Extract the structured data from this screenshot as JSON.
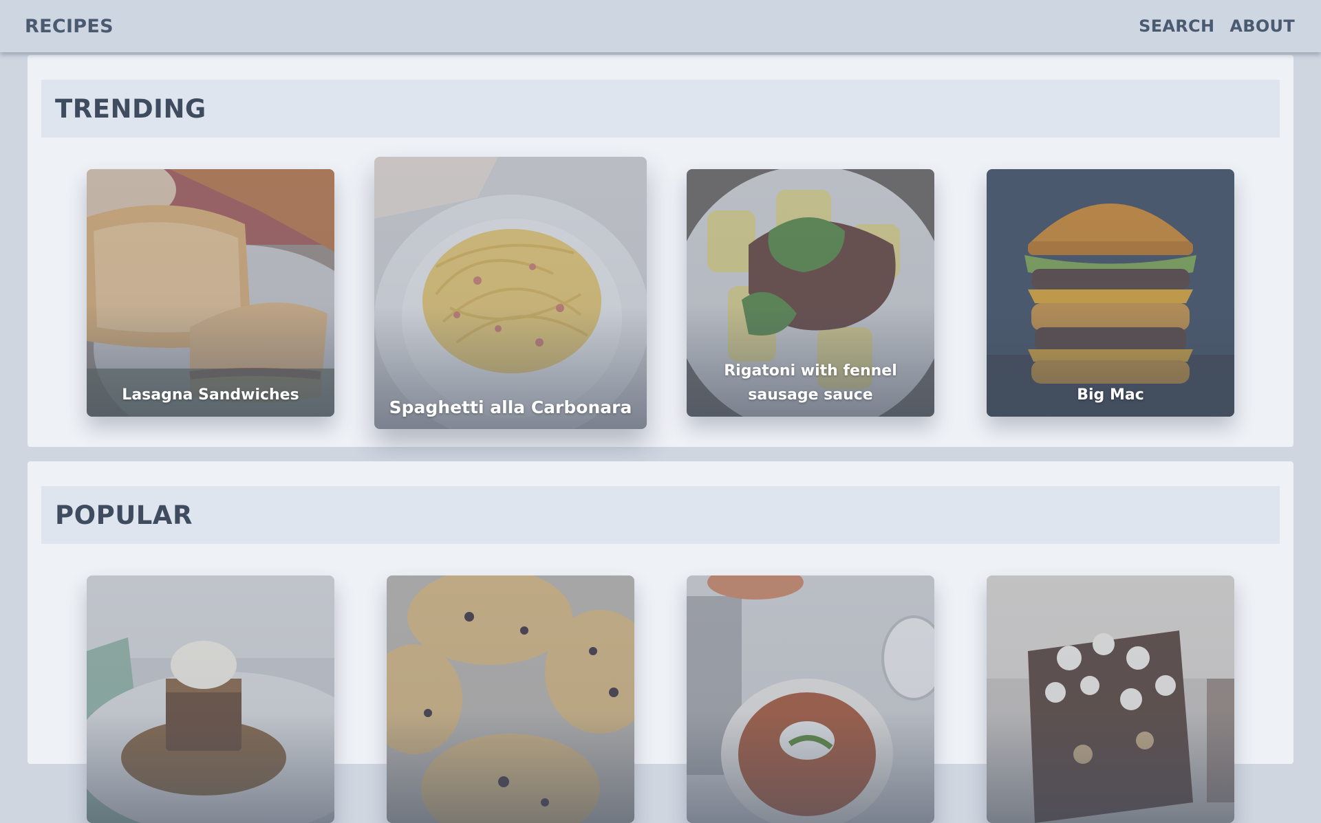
{
  "nav": {
    "brand": "RECIPES",
    "links": [
      "SEARCH",
      "ABOUT"
    ]
  },
  "sections": [
    {
      "title": "TRENDING",
      "cards": [
        {
          "title": "Lasagna Sandwiches",
          "image": "grilled-sandwich"
        },
        {
          "title": "Spaghetti alla Carbonara",
          "image": "spaghetti-plate"
        },
        {
          "title": "Rigatoni with fennel sausage sauce",
          "image": "rigatoni-plate"
        },
        {
          "title": "Big Mac",
          "image": "burger"
        }
      ]
    },
    {
      "title": "POPULAR",
      "cards": [
        {
          "title": "",
          "image": "sticky-toffee-pudding"
        },
        {
          "title": "",
          "image": "scones"
        },
        {
          "title": "",
          "image": "chili-bowl"
        },
        {
          "title": "",
          "image": "rocky-road"
        }
      ]
    }
  ]
}
